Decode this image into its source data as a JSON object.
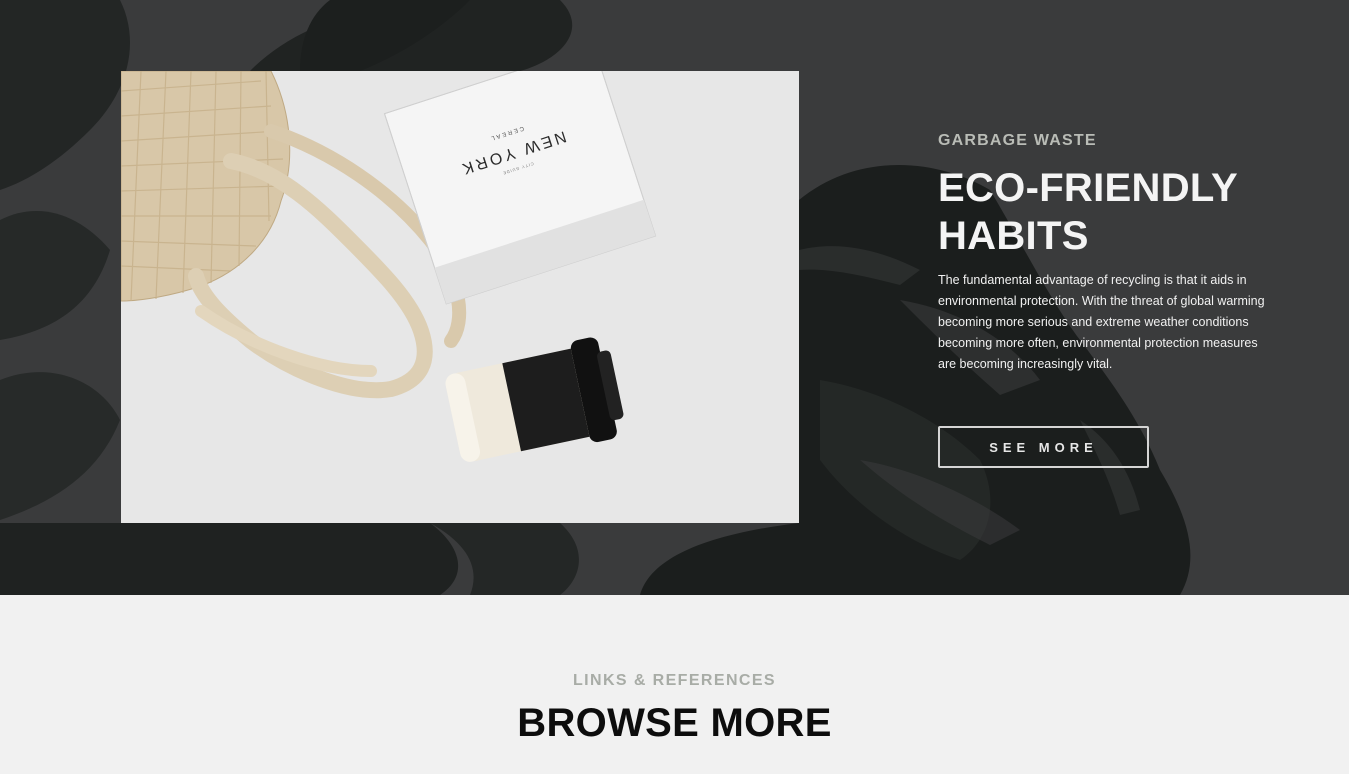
{
  "hero": {
    "eyebrow": "GARBAGE WASTE",
    "title_line1": "ECO-FRIENDLY",
    "title_line2": "HABITS",
    "description": "The fundamental advantage of recycling is that it aids in environmental protection. With the threat of global warming becoming more serious and extreme weather conditions becoming more often, environmental protection measures are becoming increasingly vital.",
    "button_label": "SEE MORE",
    "photo_text": {
      "notebook_title": "NEW YORK",
      "notebook_subtitle": "CEREAL",
      "notebook_small": "CITY GUIDE"
    }
  },
  "links": {
    "eyebrow": "LINKS & REFERENCES",
    "title": "BROWSE MORE"
  },
  "colors": {
    "hero_background": "#3a3b3c",
    "leaf": "#1f2321",
    "section_background": "#f1f1f1"
  }
}
